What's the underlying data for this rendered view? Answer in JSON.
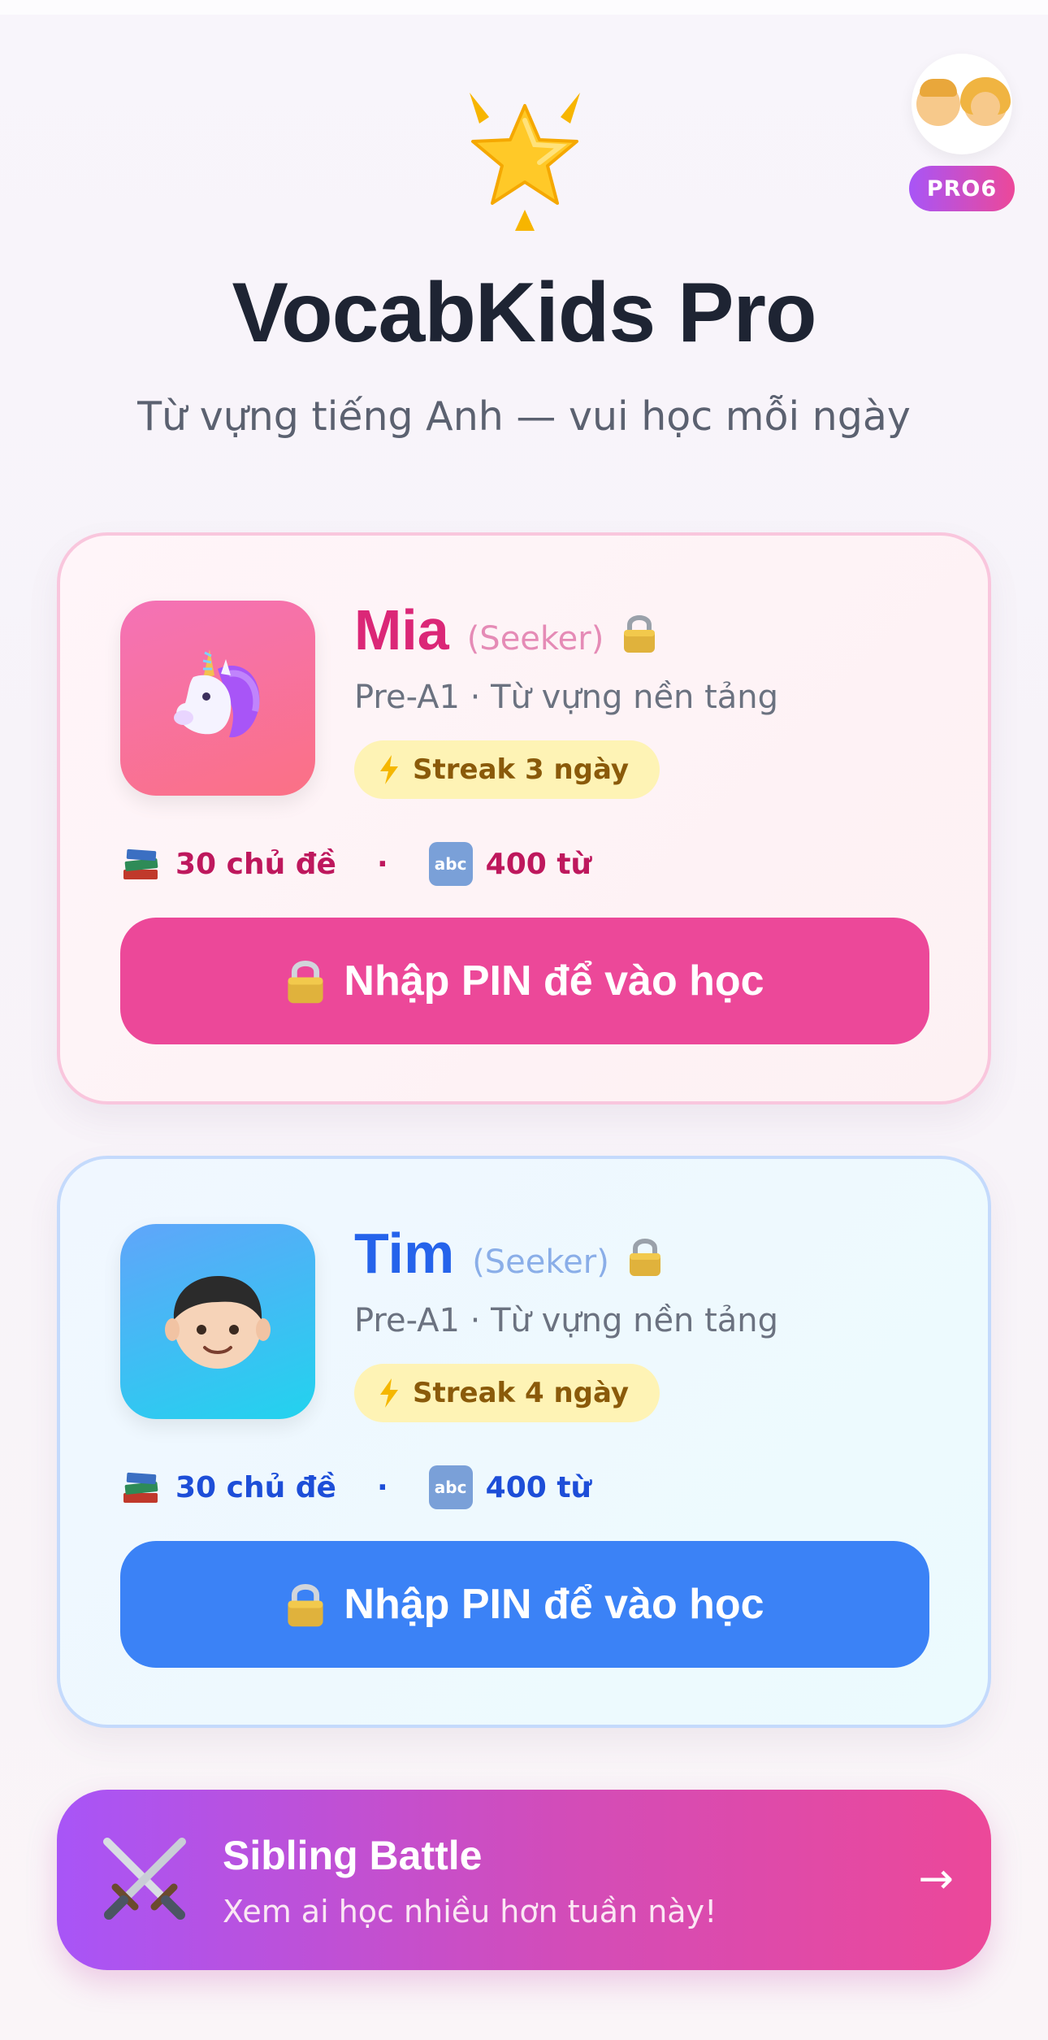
{
  "app": {
    "title": "VocabKids Pro",
    "subtitle": "Từ vựng tiếng Anh — vui học mỗi ngày",
    "logo_icon": "glowing-star-icon"
  },
  "parent": {
    "avatar_icon": "parents-icon",
    "badge": "PRO6"
  },
  "profiles": [
    {
      "name": "Mia",
      "role": "(Seeker)",
      "avatar_icon": "unicorn-icon",
      "locked": true,
      "level": "Pre-A1 · Từ vựng nền tảng",
      "streak": "Streak 3 ngày",
      "topics": "30 chủ đề",
      "separator": "·",
      "words": "400 từ",
      "abc_label": "abc",
      "button": "Nhập PIN để vào học",
      "accent": "#ec4899"
    },
    {
      "name": "Tim",
      "role": "(Seeker)",
      "avatar_icon": "boy-icon",
      "locked": true,
      "level": "Pre-A1 · Từ vựng nền tảng",
      "streak": "Streak 4 ngày",
      "topics": "30 chủ đề",
      "separator": "·",
      "words": "400 từ",
      "abc_label": "abc",
      "button": "Nhập PIN để vào học",
      "accent": "#3b82f6"
    }
  ],
  "battle": {
    "title": "Sibling Battle",
    "subtitle": "Xem ai học nhiều hơn tuần này!",
    "arrow": "→",
    "icon": "crossed-swords-icon"
  }
}
